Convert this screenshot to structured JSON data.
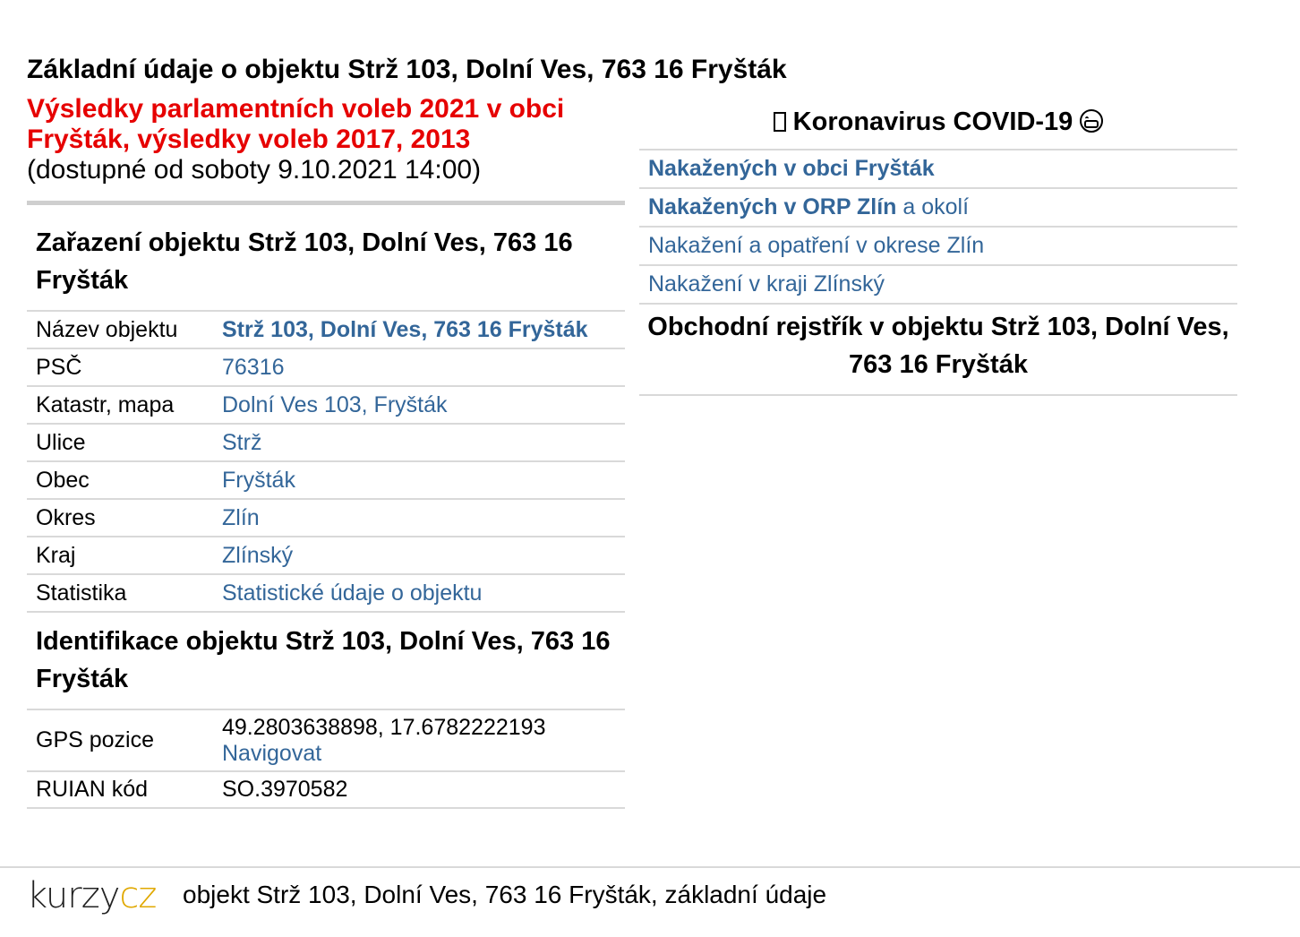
{
  "page_title": "Základní údaje o objektu Strž 103, Dolní Ves, 763 16 Fryšták",
  "elections": {
    "link_text": "Výsledky parlamentních voleb 2021 v obci Fryšták, výsledky voleb 2017, 2013",
    "availability": "(dostupné od soboty 9.10.2021 14:00)"
  },
  "classification": {
    "heading": "Zařazení objektu Strž 103, Dolní Ves, 763 16 Fryšták",
    "rows": [
      {
        "label": "Název objektu",
        "value": "Strž 103, Dolní Ves, 763 16 Fryšták"
      },
      {
        "label": "PSČ",
        "value": "76316"
      },
      {
        "label": "Katastr, mapa",
        "value": "Dolní Ves 103, Fryšták"
      },
      {
        "label": "Ulice",
        "value": "Strž"
      },
      {
        "label": "Obec",
        "value": "Fryšták"
      },
      {
        "label": "Okres",
        "value": "Zlín"
      },
      {
        "label": "Kraj",
        "value": "Zlínský"
      },
      {
        "label": "Statistika",
        "value": "Statistické údaje o objektu"
      }
    ]
  },
  "identification": {
    "heading": "Identifikace objektu Strž 103, Dolní Ves, 763 16 Fryšták",
    "gps_label": "GPS pozice",
    "gps_value": "49.2803638898, 17.6782222193",
    "navigate_link": "Navigovat",
    "ruian_label": "RUIAN kód",
    "ruian_value": "SO.3970582"
  },
  "covid": {
    "heading": "Koronavirus COVID-19",
    "icons": [
      "virus-icon",
      "face-mask-icon"
    ],
    "items": [
      {
        "bold": "Nakažených v obci Fryšták",
        "rest": ""
      },
      {
        "bold": "Nakažených v ORP Zlín",
        "rest": " a okolí"
      },
      {
        "bold": "",
        "rest": "Nakažení a opatření v okrese Zlín"
      },
      {
        "bold": "",
        "rest": "Nakažení v kraji Zlínský"
      }
    ]
  },
  "business_register": {
    "heading": "Obchodní rejstřík v objektu Strž 103, Dolní Ves, 763 16 Fryšták"
  },
  "footer": {
    "logo_left": "kurzy",
    "logo_right": "cz",
    "text": "objekt Strž 103, Dolní Ves, 763 16 Fryšták, základní údaje"
  },
  "colors": {
    "link": "#336699",
    "elections_red": "#e60000",
    "logo_accent": "#e0a800",
    "divider": "#d9d9d9"
  }
}
